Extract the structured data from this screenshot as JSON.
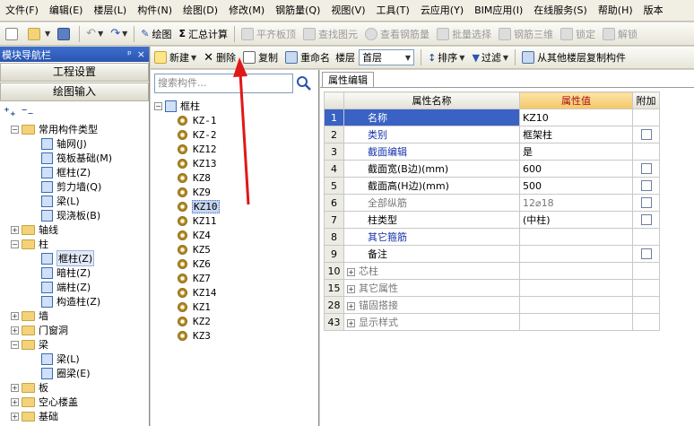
{
  "menubar": {
    "items": [
      "文件(F)",
      "编辑(E)",
      "楼层(L)",
      "构件(N)",
      "绘图(D)",
      "修改(M)",
      "钢筋量(Q)",
      "视图(V)",
      "工具(T)",
      "云应用(Y)",
      "BIM应用(I)",
      "在线服务(S)",
      "帮助(H)",
      "版本"
    ]
  },
  "toolbar": {
    "draw": "绘图",
    "sum_calc": "汇总计算",
    "level_slab": "平齐板顶",
    "find_element": "查找图元",
    "view_rebar": "查看钢筋量",
    "batch_select": "批量选择",
    "rebar_3d": "钢筋三维",
    "lock": "锁定",
    "unlock": "解锁"
  },
  "nav": {
    "title": "模块导航栏",
    "pin": "ᵖ",
    "close": "×",
    "project_settings": "工程设置",
    "drawing_input": "绘图输入",
    "tree": [
      {
        "label": "常用构件类型",
        "level": 0,
        "type": "folder",
        "expanded": true
      },
      {
        "label": "轴网(J)",
        "level": 1,
        "type": "node"
      },
      {
        "label": "筏板基础(M)",
        "level": 1,
        "type": "node"
      },
      {
        "label": "框柱(Z)",
        "level": 1,
        "type": "node"
      },
      {
        "label": "剪力墙(Q)",
        "level": 1,
        "type": "node"
      },
      {
        "label": "梁(L)",
        "level": 1,
        "type": "node"
      },
      {
        "label": "现浇板(B)",
        "level": 1,
        "type": "node"
      },
      {
        "label": "轴线",
        "level": 0,
        "type": "folder",
        "expanded": false
      },
      {
        "label": "柱",
        "level": 0,
        "type": "folder",
        "expanded": true
      },
      {
        "label": "框柱(Z)",
        "level": 1,
        "type": "node",
        "selected": true
      },
      {
        "label": "暗柱(Z)",
        "level": 1,
        "type": "node"
      },
      {
        "label": "端柱(Z)",
        "level": 1,
        "type": "node"
      },
      {
        "label": "构造柱(Z)",
        "level": 1,
        "type": "node"
      },
      {
        "label": "墙",
        "level": 0,
        "type": "folder",
        "expanded": false
      },
      {
        "label": "门窗洞",
        "level": 0,
        "type": "folder",
        "expanded": false
      },
      {
        "label": "梁",
        "level": 0,
        "type": "folder",
        "expanded": true
      },
      {
        "label": "梁(L)",
        "level": 1,
        "type": "node"
      },
      {
        "label": "圈梁(E)",
        "level": 1,
        "type": "node"
      },
      {
        "label": "板",
        "level": 0,
        "type": "folder",
        "expanded": false
      },
      {
        "label": "空心楼盖",
        "level": 0,
        "type": "folder",
        "expanded": false
      },
      {
        "label": "基础",
        "level": 0,
        "type": "folder",
        "expanded": false
      }
    ]
  },
  "comp_toolbar": {
    "new": "新建",
    "delete": "删除",
    "copy": "复制",
    "rename": "重命名",
    "floor_label": "楼层",
    "floor_value": "首层",
    "sort": "排序",
    "filter": "过滤",
    "copy_from_floor": "从其他楼层复制构件"
  },
  "components": {
    "search_placeholder": "搜索构件...",
    "root": "框柱",
    "items": [
      "KZ-1",
      "KZ-2",
      "KZ12",
      "KZ13",
      "KZ8",
      "KZ9",
      "KZ10",
      "KZ11",
      "KZ4",
      "KZ5",
      "KZ6",
      "KZ7",
      "KZ14",
      "KZ1",
      "KZ2",
      "KZ3"
    ],
    "selected": "KZ10"
  },
  "props": {
    "tab": "属性编辑",
    "headers": {
      "name": "属性名称",
      "value": "属性值",
      "extra": "附加"
    },
    "rows": [
      {
        "idx": "1",
        "name": "名称",
        "value": "KZ10",
        "style": "blue",
        "check": false,
        "current": true
      },
      {
        "idx": "2",
        "name": "类别",
        "value": "框架柱",
        "style": "blue",
        "check": true
      },
      {
        "idx": "3",
        "name": "截面编辑",
        "value": "是",
        "style": "blue",
        "check": false
      },
      {
        "idx": "4",
        "name": "截面宽(B边)(mm)",
        "value": "600",
        "style": "",
        "check": true
      },
      {
        "idx": "5",
        "name": "截面高(H边)(mm)",
        "value": "500",
        "style": "",
        "check": true
      },
      {
        "idx": "6",
        "name": "全部纵筋",
        "value": "12⌀18",
        "style": "gray",
        "check": true
      },
      {
        "idx": "7",
        "name": "柱类型",
        "value": "(中柱)",
        "style": "",
        "check": true
      },
      {
        "idx": "8",
        "name": "其它箍筋",
        "value": "",
        "style": "blue",
        "check": false
      },
      {
        "idx": "9",
        "name": "备注",
        "value": "",
        "style": "",
        "check": true
      },
      {
        "idx": "10",
        "name": "芯柱",
        "value": "",
        "style": "gray",
        "group": true
      },
      {
        "idx": "15",
        "name": "其它属性",
        "value": "",
        "style": "gray",
        "group": true
      },
      {
        "idx": "28",
        "name": "锚固搭接",
        "value": "",
        "style": "gray",
        "group": true
      },
      {
        "idx": "43",
        "name": "显示样式",
        "value": "",
        "style": "gray",
        "group": true
      }
    ]
  },
  "colors": {
    "title_bar": "#2a55b0",
    "selection": "#3a62c4",
    "arrow": "#e01818"
  }
}
